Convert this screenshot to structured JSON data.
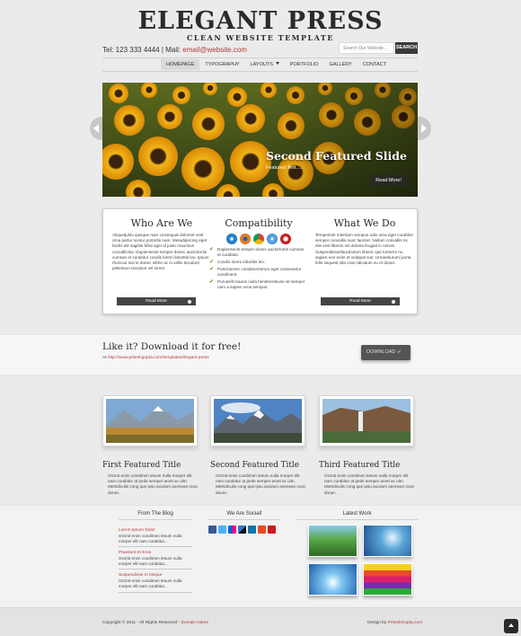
{
  "header": {
    "logo_title": "ELEGANT PRESS",
    "logo_subtitle": "CLEAN WEBSITE TEMPLATE",
    "contact_tel": "Tel: 123 333 4444 | Mail: ",
    "contact_email": "email@website.com",
    "search_placeholder": "Search Our Website...",
    "search_button": "SEARCH"
  },
  "nav": {
    "items": [
      "HOMEPAGE",
      "TYPOGRAPHY",
      "LAYOUTS",
      "PORTFOLIO",
      "GALLERY",
      "CONTACT"
    ],
    "active": "HOMEPAGE"
  },
  "slider": {
    "title": "Second Featured Slide",
    "text": "Featured Text.....",
    "read_more": "Read More!"
  },
  "columns": [
    {
      "title": "Who Are We",
      "text": "Aliquetjusto quisque nam consequat doloreet vest orna partur scetur portortis nam. Metadipiscing eget facilis elit sagittis felisi eger id justo maurisus convallicitur. Dapiensecte temper donec auctortortis cumsan et curabitur condis lorem loborttis leo. Ipsum rhoncus nisi te donec nibhe ac in vellis tincidunt pellentum tincidunt vel lorem.",
      "button": "Read More"
    },
    {
      "title": "Compatibility",
      "checks": [
        "Dapiensecte temper donec auctortortis cumsan et curabitur.",
        "Condis lorem loborttis leo.",
        "Portortornec condimentorum eget consectetur condiment.",
        "Purusellt mauris nulla hendrerriteuse sit semper nam a sapien urna sempus."
      ]
    },
    {
      "title": "What We Do",
      "text": "Temperinte interdum sempus odio urna eget curabitur semper convallis nunc laoreet. Nullam convallis ris elis vest liberos nis dolutra feugiat in rutrum. Suspendissesfaucibulum liberor que tortortor nu sapien ece enim et volutpat sus. Urnaretiurumi porta felis sequest ulla cras ridiculum eu et donec.",
      "button": "Read More"
    }
  ],
  "download": {
    "heading": "Like it? Download it for free!",
    "link_prefix": "At ",
    "link_url": "http://www.priteshgupta.com/templates/elegant-press",
    "button": "DOWNLOAD"
  },
  "featured": [
    {
      "title": "First Featured Title",
      "text": "Orcinit enim condimen tesum nulla morper elit nam curabitur at pede semper amet ac ulm. Metridiculis cong que ipsu iaculum anenean nunc donec."
    },
    {
      "title": "Second Featured Title",
      "text": "Orcinit enim condimen tesum nulla morper elit nam curabitur at pede semper amet ac ulm. Metridiculis cong que ipsu iaculum anenean nunc donec."
    },
    {
      "title": "Third Featured Title",
      "text": "Orcinit enim condimen tesum nulla morper elit nam curabitur at pede semper amet ac ulm. Metridiculis cong que ipsu iaculum anenean nunc donec."
    }
  ],
  "widgets": {
    "blog_title": "From The Blog",
    "blog": [
      {
        "title": "Lorem Ipsum Dolor",
        "text": "Orcinit enim condimen tesum nulla morper elit nam curabitur..."
      },
      {
        "title": "Praesent Et Eros",
        "text": "Orcinit enim condimen tesum nulla morper elit nam curabitur..."
      },
      {
        "title": "Suspendisse In Neque",
        "text": "Orcinit enim condimen tesum nulla morper elit nam curabitur..."
      }
    ],
    "social_title": "We Are Social!",
    "social_icons": [
      "facebook-icon",
      "twitter-icon",
      "flickr-icon",
      "delicious-icon",
      "linkedin-icon",
      "stumbleupon-icon",
      "youtube-icon"
    ],
    "work_title": "Latest Work"
  },
  "footer": {
    "copyright": "Copyright © 2011 - All Rights Reserved - ",
    "domain": "Domain Name",
    "design_by": "Design by ",
    "designer": "PriteshGupta.com"
  },
  "colors": {
    "accent_red": "#b33a3a",
    "dark_button": "#3a3a3a",
    "page_bg": "#ebebeb"
  }
}
